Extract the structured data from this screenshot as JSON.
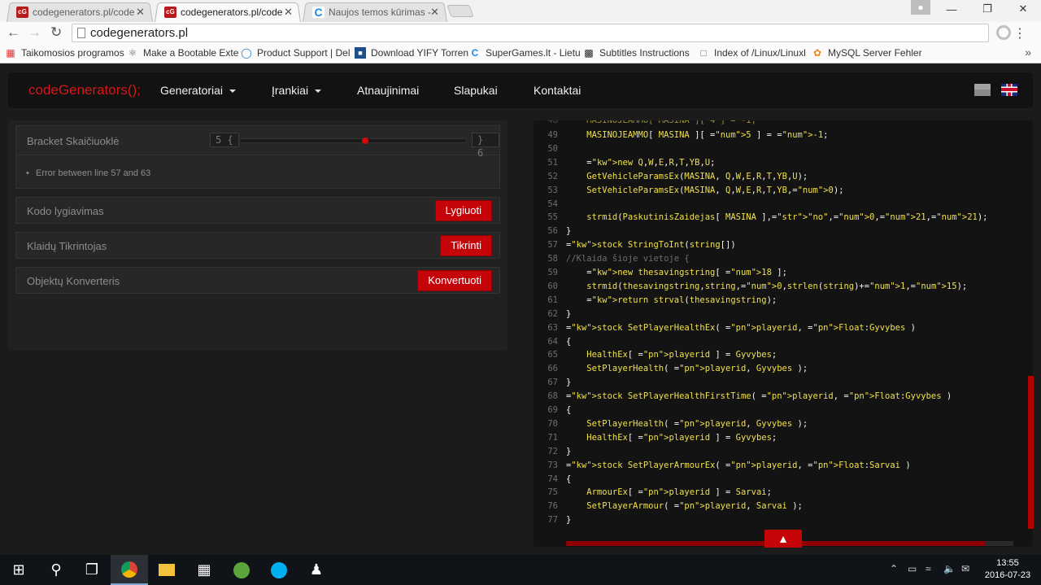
{
  "browser": {
    "tabs": [
      {
        "title": "codegenerators.pl/code -",
        "favicon": "cG",
        "active": false
      },
      {
        "title": "codegenerators.pl/code -",
        "favicon": "cG",
        "active": true
      },
      {
        "title": "Naujos temos kūrimas - S",
        "favicon": "C",
        "active": false
      }
    ],
    "close_glyph": "✕",
    "url": "codegenerators.pl",
    "bookmarks": [
      {
        "label": "Taikomosios programos",
        "icon": "apps-icon"
      },
      {
        "label": "Make a Bootable Exte",
        "icon": "usb-icon"
      },
      {
        "label": "Product Support | Del",
        "icon": "dell-icon"
      },
      {
        "label": "Download YIFY Torren",
        "icon": "yify-icon"
      },
      {
        "label": "SuperGames.lt - Lietu",
        "icon": "supergames-icon"
      },
      {
        "label": "Subtitles Instructions",
        "icon": "film-icon"
      },
      {
        "label": "Index of /Linux/Linuxl",
        "icon": "page-icon"
      },
      {
        "label": "MySQL Server Fehler",
        "icon": "mysql-icon"
      }
    ]
  },
  "site": {
    "brand": "codeGenerators();",
    "nav": {
      "generatoriai": "Generatoriai",
      "irankiai": "Įrankiai",
      "atnaujinimai": "Atnaujinimai",
      "slapukai": "Slapukai",
      "kontaktai": "Kontaktai"
    },
    "bracket": {
      "title": "Bracket Skaičiuoklė",
      "open_count": "5 {",
      "close_count": "} 6",
      "error": "Error between line 57 and 63"
    },
    "tools": [
      {
        "label": "Kodo lygiavimas",
        "button": "Lygiuoti"
      },
      {
        "label": "Klaidų Tikrintojas",
        "button": "Tikrinti"
      },
      {
        "label": "Objektų Konverteris",
        "button": "Konvertuoti"
      }
    ],
    "code": [
      {
        "n": "49",
        "text": "    MASINOJEAMMO[ MASINA ][ 5 ] = -1;"
      },
      {
        "n": "50",
        "text": ""
      },
      {
        "n": "51",
        "text": "    new Q,W,E,R,T,YB,U;"
      },
      {
        "n": "52",
        "text": "    GetVehicleParamsEx(MASINA, Q,W,E,R,T,YB,U);"
      },
      {
        "n": "53",
        "text": "    SetVehicleParamsEx(MASINA, Q,W,E,R,T,YB,0);"
      },
      {
        "n": "54",
        "text": ""
      },
      {
        "n": "55",
        "text": "    strmid(PaskutinisZaidejas[ MASINA ],\"no\",0,21,21);"
      },
      {
        "n": "56",
        "text": "}"
      },
      {
        "n": "57",
        "text": "stock StringToInt(string[])"
      },
      {
        "n": "58",
        "text": "//Klaida šioje vietoje {"
      },
      {
        "n": "59",
        "text": "    new thesavingstring[ 18 ];"
      },
      {
        "n": "60",
        "text": "    strmid(thesavingstring,string,0,strlen(string)+1,15);"
      },
      {
        "n": "61",
        "text": "    return strval(thesavingstring);"
      },
      {
        "n": "62",
        "text": "}"
      },
      {
        "n": "63",
        "text": "stock SetPlayerHealthEx( playerid, Float:Gyvybes )"
      },
      {
        "n": "64",
        "text": "{"
      },
      {
        "n": "65",
        "text": "    HealthEx[ playerid ] = Gyvybes;"
      },
      {
        "n": "66",
        "text": "    SetPlayerHealth( playerid, Gyvybes );"
      },
      {
        "n": "67",
        "text": "}"
      },
      {
        "n": "68",
        "text": "stock SetPlayerHealthFirstTime( playerid, Float:Gyvybes )"
      },
      {
        "n": "69",
        "text": "{"
      },
      {
        "n": "70",
        "text": "    SetPlayerHealth( playerid, Gyvybes );"
      },
      {
        "n": "71",
        "text": "    HealthEx[ playerid ] = Gyvybes;"
      },
      {
        "n": "72",
        "text": "}"
      },
      {
        "n": "73",
        "text": "stock SetPlayerArmourEx( playerid, Float:Sarvai )"
      },
      {
        "n": "74",
        "text": "{"
      },
      {
        "n": "75",
        "text": "    ArmourEx[ playerid ] = Sarvai;"
      },
      {
        "n": "76",
        "text": "    SetPlayerArmour( playerid, Sarvai );"
      },
      {
        "n": "77",
        "text": "}"
      }
    ],
    "colors": {
      "accent": "#c5040a",
      "brand": "#d41818",
      "code_text": "#f0e04a",
      "keyword": "#ff3333",
      "number": "#b07fff"
    }
  },
  "taskbar": {
    "time": "13:55",
    "date": "2016-07-23"
  }
}
